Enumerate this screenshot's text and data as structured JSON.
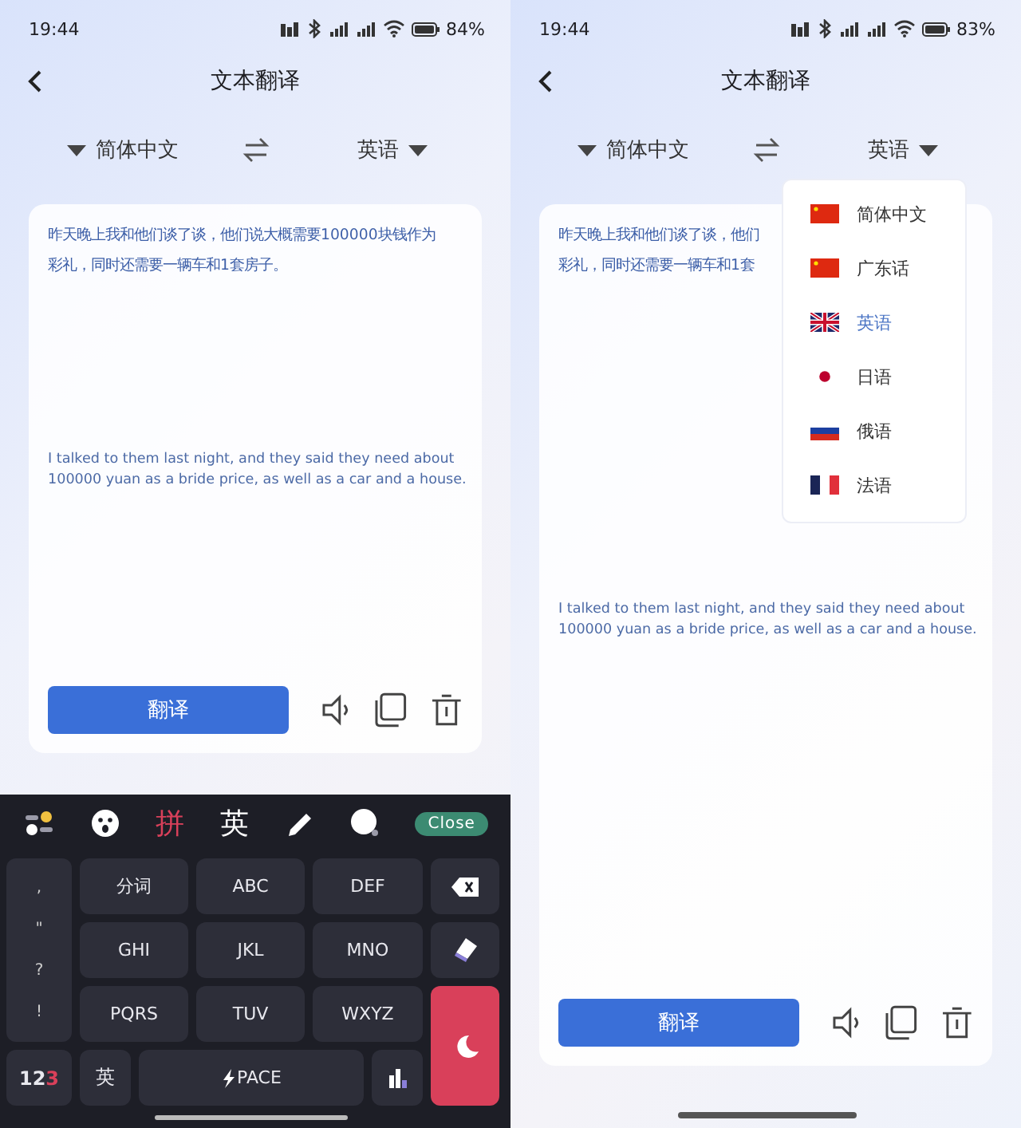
{
  "screens": [
    {
      "status_bar": {
        "time": "19:44",
        "battery": "84%"
      },
      "header": {
        "title": "文本翻译"
      },
      "languages": {
        "source": "简体中文",
        "target": "英语"
      },
      "source_lines": [
        "昨天晚上我和他们谈了谈，他们说大概需要100000块钱作为",
        "彩礼，同时还需要一辆车和1套房子。"
      ],
      "translation_lines": [
        "I talked to them last night, and they said they need about",
        "100000 yuan as a bride price, as well as a car and a house."
      ],
      "translate_button": "翻译",
      "keyboard": {
        "modes": [
          {
            "label": "拼",
            "selected": true
          },
          {
            "label": "英",
            "selected": false
          }
        ],
        "close": "Close",
        "punctuation": [
          ",",
          "\"",
          "?",
          "!"
        ],
        "keys": [
          {
            "label": "分词"
          },
          {
            "label": "ABC"
          },
          {
            "label": "DEF"
          },
          {
            "label": "GHI"
          },
          {
            "label": "JKL"
          },
          {
            "label": "MNO"
          },
          {
            "label": "PQRS"
          },
          {
            "label": "TUV"
          },
          {
            "label": "WXYZ"
          }
        ],
        "number_key": [
          {
            "text": "12",
            "accent": false
          },
          {
            "text": "3",
            "accent": true
          }
        ],
        "lang_key": "英",
        "space": "PACE"
      }
    },
    {
      "status_bar": {
        "time": "19:44",
        "battery": "83%"
      },
      "header": {
        "title": "文本翻译"
      },
      "languages": {
        "source": "简体中文",
        "target": "英语"
      },
      "source_lines": [
        "昨天晚上我和他们谈了谈，他们",
        "彩礼，同时还需要一辆车和1套"
      ],
      "translation_lines": [
        "I talked to them last night, and they said they need about",
        "100000 yuan as a bride price, as well as a car and a house."
      ],
      "translate_button": "翻译",
      "dropdown": {
        "items": [
          {
            "label": "简体中文",
            "kind": "cn",
            "selected": false
          },
          {
            "label": "广东话",
            "kind": "cn",
            "selected": false
          },
          {
            "label": "英语",
            "kind": "uk",
            "selected": true
          },
          {
            "label": "日语",
            "kind": "jp",
            "selected": false
          },
          {
            "label": "俄语",
            "kind": "ru",
            "selected": false
          },
          {
            "label": "法语",
            "kind": "fr",
            "selected": false
          }
        ]
      }
    }
  ]
}
